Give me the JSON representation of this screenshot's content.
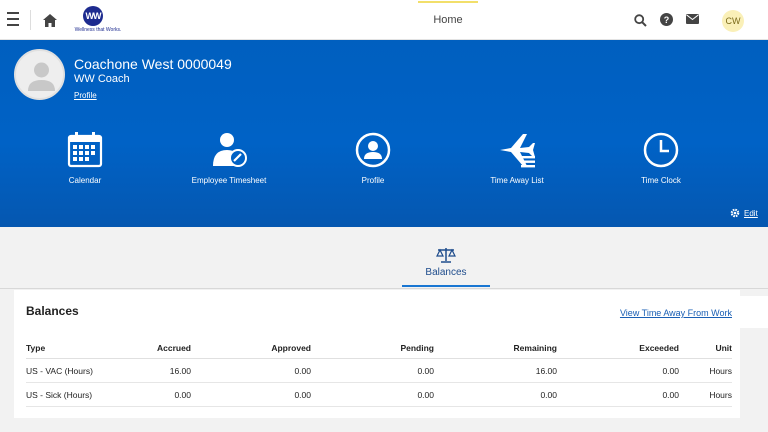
{
  "topbar": {
    "logo_text": "WW",
    "logo_tagline": "Wellness that Works.",
    "home_tab": "Home",
    "avatar_initials": "CW"
  },
  "profile": {
    "name": "Coachone West 0000049",
    "role": "WW Coach",
    "link": "Profile"
  },
  "tiles": [
    {
      "label": "Calendar",
      "icon": "calendar-icon"
    },
    {
      "label": "Employee Timesheet",
      "icon": "employee-timesheet-icon"
    },
    {
      "label": "Profile",
      "icon": "profile-icon"
    },
    {
      "label": "Time Away List",
      "icon": "time-away-list-icon"
    },
    {
      "label": "Time Clock",
      "icon": "clock-icon"
    }
  ],
  "edit_label": "Edit",
  "balances_tab": "Balances",
  "panel": {
    "title": "Balances",
    "view_link": "View Time Away From Work",
    "columns": [
      "Type",
      "Accrued",
      "Approved",
      "Pending",
      "Remaining",
      "Exceeded",
      "Unit"
    ],
    "rows": [
      [
        "US - VAC (Hours)",
        "16.00",
        "0.00",
        "0.00",
        "16.00",
        "0.00",
        "Hours"
      ],
      [
        "US - Sick (Hours)",
        "0.00",
        "0.00",
        "0.00",
        "0.00",
        "0.00",
        "Hours"
      ]
    ]
  },
  "colors": {
    "banner": "#0062c6",
    "accent": "#1976d2",
    "link": "#1a5fb4"
  }
}
